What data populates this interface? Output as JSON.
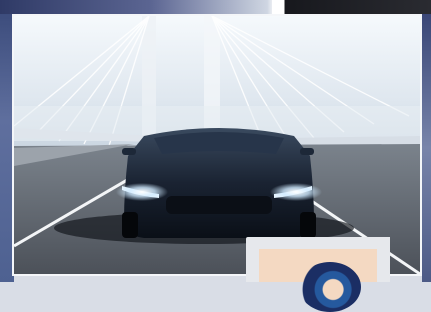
{
  "photo": {
    "subject": "sports-car-on-bridge-road",
    "colors": {
      "sky": "#dfe7ef",
      "road": "#5e646c",
      "car_body": "#1a2332",
      "headlight": "#e9f6ff",
      "frame_border": "#f4f6f9",
      "left_border": "#4e6191",
      "right_border": "#4c5a86"
    }
  },
  "overlay_card": {
    "colors": {
      "card": "#e6e8ec",
      "inner": "#f4d9c2",
      "logo_blue": "#25599e",
      "logo_navy": "#1b2e64"
    }
  }
}
